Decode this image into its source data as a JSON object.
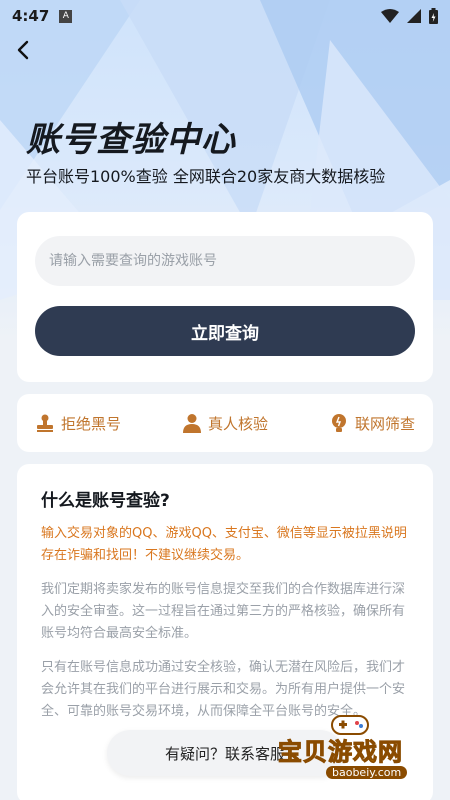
{
  "status": {
    "time": "4:47",
    "a_badge": "A"
  },
  "header": {
    "title": "账号查验中心",
    "subtitle": "平台账号100%查验  全网联合20家友商大数据核验"
  },
  "search": {
    "placeholder": "请输入需要查询的游戏账号",
    "value": "",
    "button_label": "立即查询"
  },
  "features": [
    {
      "label": "拒绝黑号",
      "icon": "stamp-icon"
    },
    {
      "label": "真人核验",
      "icon": "person-icon"
    },
    {
      "label": "联网筛查",
      "icon": "bulb-icon"
    }
  ],
  "info": {
    "title": "什么是账号查验?",
    "warning": "输入交易对象的QQ、游戏QQ、支付宝、微信等显示被拉黑说明存在诈骗和找回！不建议继续交易。",
    "para1": "我们定期将卖家发布的账号信息提交至我们的合作数据库进行深入的安全审查。这一过程旨在通过第三方的严格核验，确保所有账号均符合最高安全标准。",
    "para2": "只有在账号信息成功通过安全核验，确认无潜在风险后，我们才会允许其在我们的平台进行展示和交易。为所有用户提供一个安全、可靠的账号交易环境，从而保障全平台账号的安全。"
  },
  "contact": {
    "label": "有疑问？联系客服"
  },
  "watermark": {
    "text": "宝贝游戏网",
    "url": "baobeiy.com"
  },
  "colors": {
    "accent": "#2f3b52",
    "feature": "#c0752d",
    "warning": "#d9771f"
  }
}
